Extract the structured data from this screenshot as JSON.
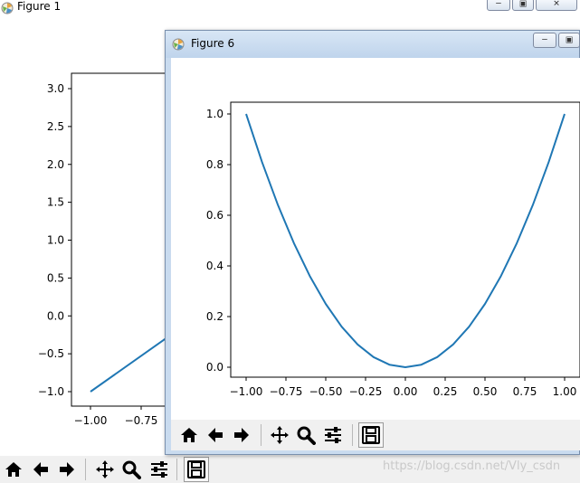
{
  "back_window": {
    "title": "Figure 1",
    "y_ticks": [
      "3.0",
      "2.5",
      "2.0",
      "1.5",
      "1.0",
      "0.5",
      "0.0",
      "−0.5",
      "−1.0"
    ],
    "x_ticks": [
      "−1.00",
      "−0.75"
    ]
  },
  "front_window": {
    "title": "Figure 6"
  },
  "toolbar": {
    "icons": [
      "home-icon",
      "back-arrow-icon",
      "forward-arrow-icon",
      "pan-icon",
      "zoom-icon",
      "configure-subplots-icon",
      "save-icon"
    ]
  },
  "watermark": "https://blog.csdn.net/Vly_csdn",
  "chart_data": [
    {
      "type": "line",
      "title": "",
      "xlabel": "",
      "ylabel": "",
      "xlim": [
        -1.1,
        -0.55
      ],
      "ylim": [
        -1.2,
        3.2
      ],
      "series": [
        {
          "x": [
            -1.0,
            -0.55
          ],
          "y": [
            -1.0,
            -0.15
          ]
        }
      ],
      "line_color": "#1f77b4"
    },
    {
      "type": "line",
      "title": "",
      "xlabel": "",
      "ylabel": "",
      "xlim": [
        -1.1,
        1.1
      ],
      "ylim": [
        -0.05,
        1.05
      ],
      "x_ticks": [
        "−1.00",
        "−0.75",
        "−0.50",
        "−0.25",
        "0.00",
        "0.25",
        "0.50",
        "0.75",
        "1.00"
      ],
      "y_ticks": [
        "0.0",
        "0.2",
        "0.4",
        "0.6",
        "0.8",
        "1.0"
      ],
      "series": [
        {
          "x": [
            -1.0,
            -0.9,
            -0.8,
            -0.7,
            -0.6,
            -0.5,
            -0.4,
            -0.3,
            -0.2,
            -0.1,
            0.0,
            0.1,
            0.2,
            0.3,
            0.4,
            0.5,
            0.6,
            0.7,
            0.8,
            0.9,
            1.0
          ],
          "y": [
            1.0,
            0.81,
            0.64,
            0.49,
            0.36,
            0.25,
            0.16,
            0.09,
            0.04,
            0.01,
            0.0,
            0.01,
            0.04,
            0.09,
            0.16,
            0.25,
            0.36,
            0.49,
            0.64,
            0.81,
            1.0
          ]
        }
      ],
      "line_color": "#1f77b4"
    }
  ]
}
